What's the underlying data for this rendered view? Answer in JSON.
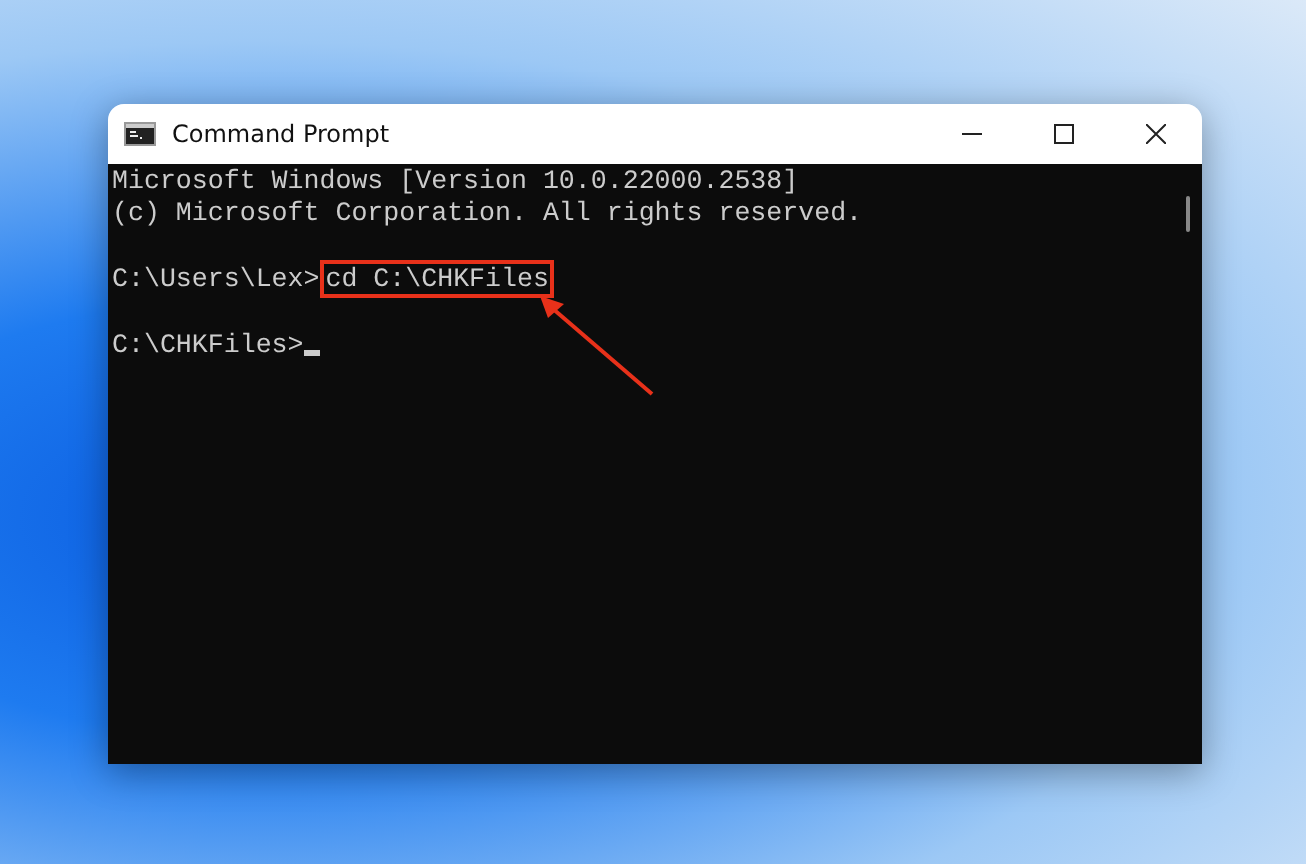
{
  "window": {
    "title": "Command Prompt"
  },
  "console": {
    "lines": [
      {
        "kind": "text",
        "text": "Microsoft Windows [Version 10.0.22000.2538]"
      },
      {
        "kind": "text",
        "text": "(c) Microsoft Corporation. All rights reserved."
      },
      {
        "kind": "blank"
      },
      {
        "kind": "prompt",
        "prompt": "C:\\Users\\Lex>",
        "command": "cd C:\\CHKFiles",
        "highlighted": true,
        "cursor": false
      },
      {
        "kind": "blank"
      },
      {
        "kind": "prompt",
        "prompt": "C:\\CHKFiles>",
        "cursor": true
      }
    ]
  }
}
